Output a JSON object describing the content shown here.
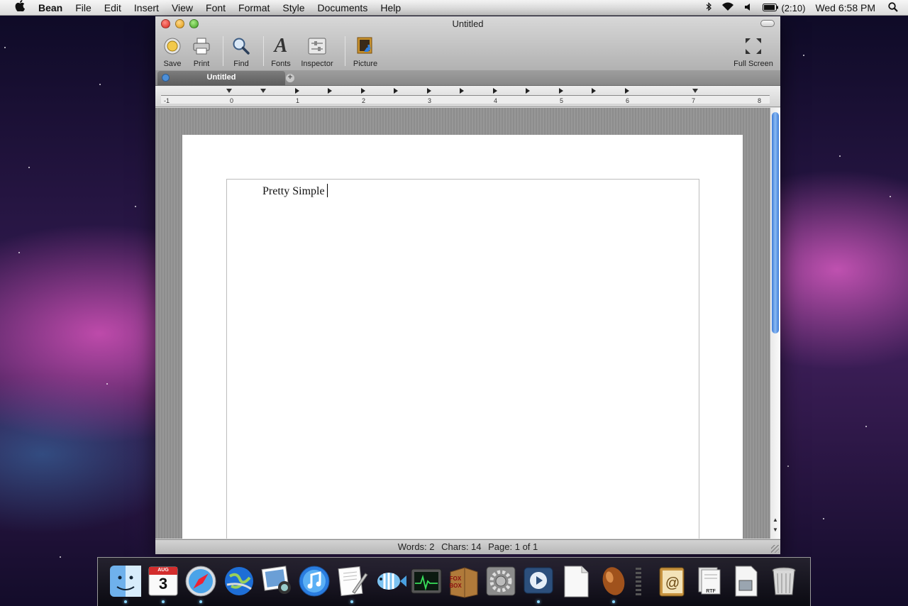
{
  "menubar": {
    "app_name": "Bean",
    "items": [
      "File",
      "Edit",
      "Insert",
      "View",
      "Font",
      "Format",
      "Style",
      "Documents",
      "Help"
    ],
    "battery_text": "(2:10)",
    "clock": "Wed 6:58 PM"
  },
  "window": {
    "title": "Untitled",
    "toolbar": {
      "save_label": "Save",
      "print_label": "Print",
      "find_label": "Find",
      "fonts_label": "Fonts",
      "inspector_label": "Inspector",
      "picture_label": "Picture",
      "fullscreen_label": "Full Screen"
    },
    "tab": {
      "label": "Untitled"
    },
    "ruler_labels": [
      "-1",
      "0",
      "1",
      "2",
      "3",
      "4",
      "5",
      "6",
      "7",
      "8"
    ],
    "document": {
      "text": "Pretty Simple"
    },
    "status": {
      "words": "Words: 2",
      "chars": "Chars: 14",
      "page": "Page: 1 of 1"
    }
  },
  "dock": {
    "apps": [
      "Finder",
      "iCal",
      "Safari",
      "Network",
      "iPhoto",
      "iTunes",
      "TextEdit",
      "Aquarium",
      "Activity Monitor",
      "FoxBox",
      "System Preferences",
      "QuickTime",
      "Document",
      "Bean",
      "Stack",
      "Address Book",
      "RTF Document",
      "Preview",
      "Trash"
    ],
    "calendar_month": "AUG",
    "calendar_day": "3",
    "foxbox_label": "FOX BOX",
    "rtf_label": "RTF"
  }
}
